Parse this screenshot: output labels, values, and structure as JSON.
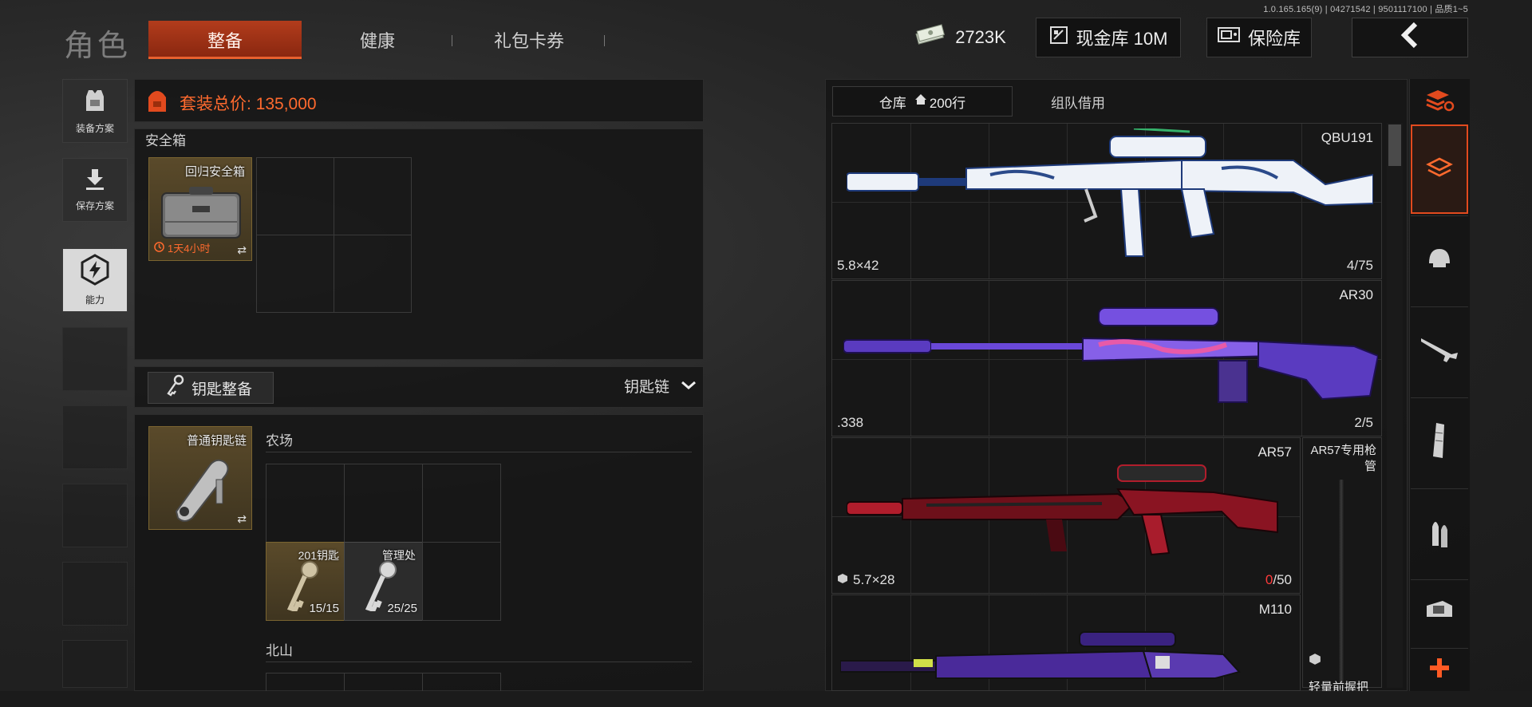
{
  "version": "1.0.165.165(9) | 04271542 | 9501117100 | 品质1~5",
  "header": {
    "title": "角色",
    "tabs": [
      {
        "label": "整备",
        "active": true
      },
      {
        "label": "健康",
        "active": false
      },
      {
        "label": "礼包卡券",
        "active": false
      }
    ],
    "currency": "2723K",
    "cash_vault": "现金库 10M",
    "safe_vault": "保险库"
  },
  "left_nav": [
    {
      "label": "装备方案",
      "icon": "vest-icon"
    },
    {
      "label": "保存方案",
      "icon": "download-icon"
    },
    {
      "label": "能力",
      "icon": "lightning-icon"
    }
  ],
  "loadout": {
    "total_label": "套装总价: 135,000",
    "safe_box": {
      "section": "安全箱",
      "item_name": "回归安全箱",
      "timer": "1天4小时"
    },
    "keys": {
      "button_label": "钥匙整备",
      "dropdown_label": "钥匙链",
      "keychain_name": "普通钥匙链",
      "area1": "农场",
      "area2": "北山",
      "key_items": [
        {
          "name": "201钥匙",
          "count": "15/15"
        },
        {
          "name": "管理处",
          "count": "25/25"
        }
      ]
    }
  },
  "warehouse": {
    "tabs": [
      {
        "label": "仓库",
        "extra": "200行",
        "active": true
      },
      {
        "label": "组队借用",
        "extra": "",
        "active": false
      }
    ],
    "weapons": [
      {
        "name": "QBU191",
        "caliber": "5.8×42",
        "ammo": "4/75",
        "color": "#e8eef6",
        "accent": "#2b4a8a"
      },
      {
        "name": "AR30",
        "caliber": ".338",
        "ammo": "2/5",
        "color": "#6a3fd0",
        "accent": "#d35aa6"
      },
      {
        "name": "AR57",
        "caliber": "5.7×28",
        "ammo_now": "0",
        "ammo_max": "/50",
        "color": "#7a1420",
        "accent": "#d22035"
      },
      {
        "name": "M110",
        "caliber": "",
        "ammo": "",
        "color": "#4a2a9a",
        "accent": "#d1e048"
      }
    ],
    "side_items": [
      {
        "name": "AR57专用枪管"
      },
      {
        "name": "轻量前握把"
      }
    ]
  },
  "side_categories": [
    "stack-refresh-icon",
    "layers-icon",
    "helmet-icon",
    "rifle-icon",
    "magazine-icon",
    "bullets-icon",
    "sight-icon",
    "plus-icon"
  ],
  "colors": {
    "accent": "#e24a1e",
    "ammo_empty": "#ff3b3b"
  }
}
